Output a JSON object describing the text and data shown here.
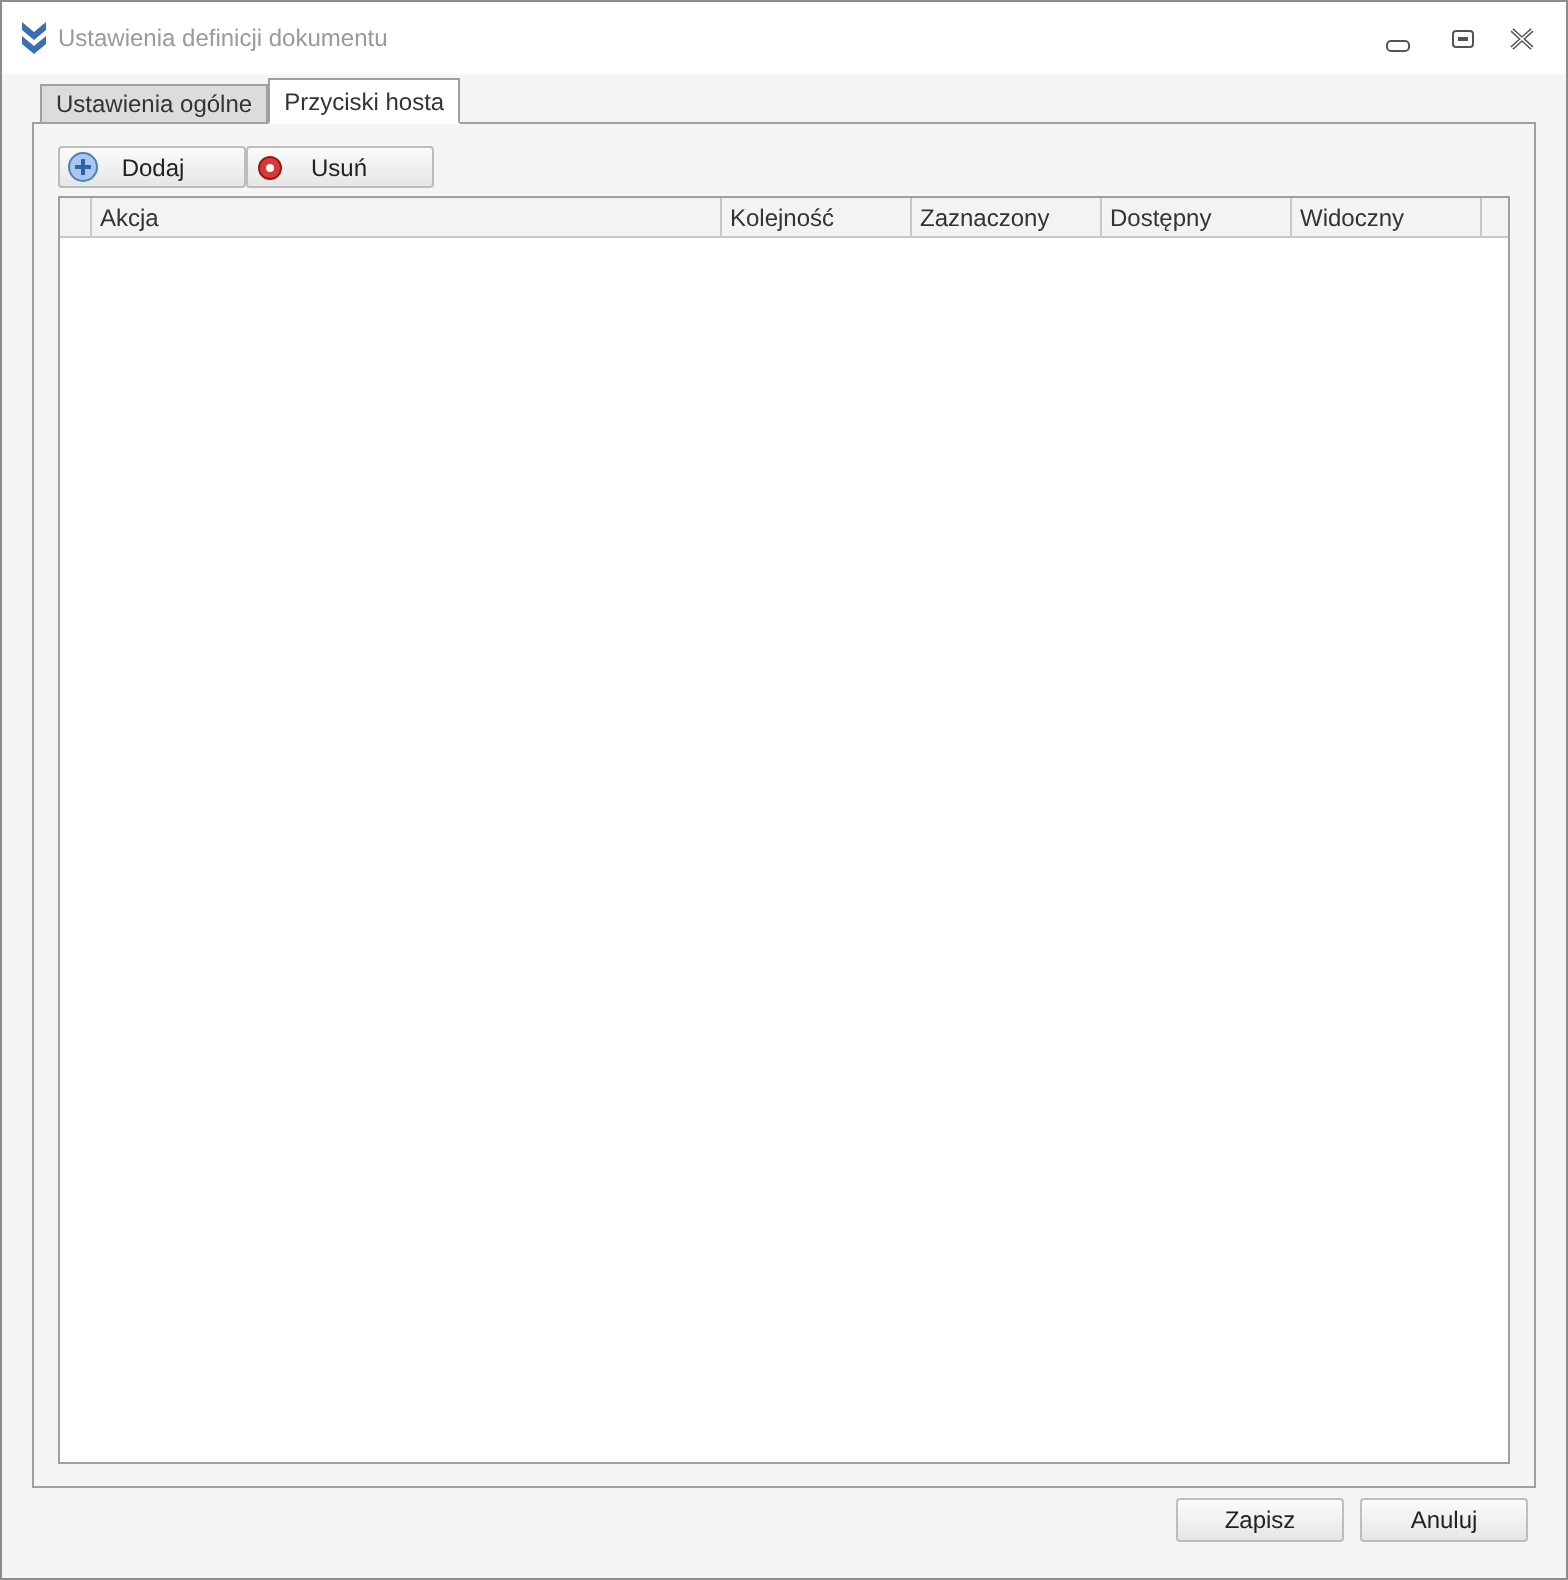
{
  "window": {
    "title": "Ustawienia definicji dokumentu"
  },
  "tabs": [
    {
      "label": "Ustawienia ogólne",
      "selected": false
    },
    {
      "label": "Przyciski hosta",
      "selected": true
    }
  ],
  "toolbar": [
    {
      "label": "Dodaj",
      "kind": "add"
    },
    {
      "label": "Usuń",
      "kind": "remove"
    }
  ],
  "table": {
    "columns": [
      "Akcja",
      "Kolejność",
      "Zaznaczony",
      "Dostępny",
      "Widoczny"
    ]
  },
  "buttons": [
    "Zapisz",
    "Anuluj"
  ]
}
